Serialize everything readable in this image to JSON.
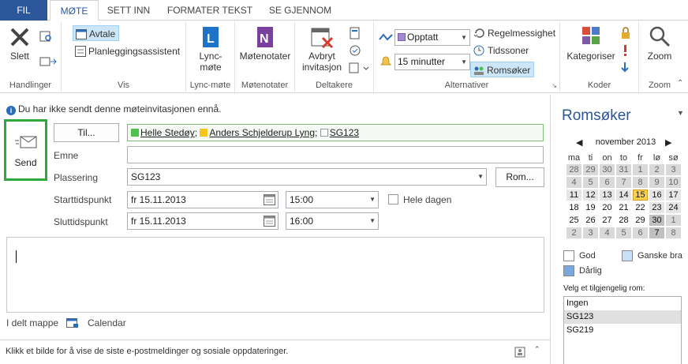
{
  "tabs": {
    "file": "FIL",
    "meeting": "MØTE",
    "insert": "SETT INN",
    "format": "FORMATER TEKST",
    "review": "SE GJENNOM"
  },
  "ribbon": {
    "actions": {
      "delete": "Slett",
      "label": "Handlinger"
    },
    "view": {
      "appointment": "Avtale",
      "scheduling": "Planleggingsassistent",
      "label": "Vis"
    },
    "lync": {
      "button_line1": "Lync-",
      "button_line2": "møte",
      "label": "Lync-møte"
    },
    "notes": {
      "button": "Møtenotater",
      "label": "Møtenotater"
    },
    "attendees": {
      "cancel_line1": "Avbryt",
      "cancel_line2": "invitasjon",
      "label": "Deltakere"
    },
    "options": {
      "show_as": "Opptatt",
      "reminder": "15 minutter",
      "recurrence": "Regelmessighet",
      "timezones": "Tidssoner",
      "room_finder": "Romsøker",
      "label": "Alternativer"
    },
    "tags": {
      "categorize": "Kategoriser",
      "label": "Koder"
    },
    "zoom": {
      "button": "Zoom",
      "label": "Zoom"
    }
  },
  "info_bar": "Du har ikke sendt denne møteinvitasjonen ennå.",
  "send": "Send",
  "form": {
    "to_button": "Til...",
    "attendees": [
      {
        "name": "Helle Stedøy",
        "color": "#4cc14c",
        "suffix": ";"
      },
      {
        "name": "Anders Schjelderup Lyng",
        "color": "#f5c518",
        "suffix": ";"
      },
      {
        "name": "SG123",
        "color": "#ffffff",
        "suffix": ""
      }
    ],
    "subject_label": "Emne",
    "subject_value": "",
    "location_label": "Plassering",
    "location_value": "SG123",
    "rooms_button": "Rom...",
    "start_label": "Starttidspunkt",
    "start_date": "fr 15.11.2013",
    "start_time": "15:00",
    "all_day": "Hele dagen",
    "end_label": "Sluttidspunkt",
    "end_date": "fr 15.11.2013",
    "end_time": "16:00"
  },
  "folder": {
    "label": "I delt mappe",
    "value": "Calendar"
  },
  "status_bar": "Klikk et bilde for å vise de siste e-postmeldinger og sosiale oppdateringer.",
  "room_finder": {
    "title": "Romsøker",
    "month": "november 2013",
    "weekdays": [
      "ma",
      "ti",
      "on",
      "to",
      "fr",
      "lø",
      "sø"
    ],
    "weeks": [
      [
        [
          "28",
          "dim"
        ],
        [
          "29",
          "dim"
        ],
        [
          "30",
          "dim"
        ],
        [
          "31",
          "dim"
        ],
        [
          "1",
          "dim"
        ],
        [
          "2",
          "dim"
        ],
        [
          "3",
          "dim"
        ]
      ],
      [
        [
          "4",
          "dim"
        ],
        [
          "5",
          "dim"
        ],
        [
          "6",
          "dim"
        ],
        [
          "7",
          "dim"
        ],
        [
          "8",
          "dim"
        ],
        [
          "9",
          "dim"
        ],
        [
          "10",
          "dim"
        ]
      ],
      [
        [
          "11",
          "ok"
        ],
        [
          "12",
          "ok"
        ],
        [
          "13",
          "ok"
        ],
        [
          "14",
          "ok"
        ],
        [
          "15",
          "today"
        ],
        [
          "16",
          "ok"
        ],
        [
          "17",
          "ok"
        ]
      ],
      [
        [
          "18",
          "w"
        ],
        [
          "19",
          "w"
        ],
        [
          "20",
          "w"
        ],
        [
          "21",
          "w"
        ],
        [
          "22",
          "w"
        ],
        [
          "23",
          "ok"
        ],
        [
          "24",
          "ok"
        ]
      ],
      [
        [
          "25",
          "w"
        ],
        [
          "26",
          "w"
        ],
        [
          "27",
          "w"
        ],
        [
          "28",
          "w"
        ],
        [
          "29",
          "w"
        ],
        [
          "30",
          "gray"
        ],
        [
          "1",
          "dim"
        ]
      ],
      [
        [
          "2",
          "dim"
        ],
        [
          "3",
          "dim"
        ],
        [
          "4",
          "dim"
        ],
        [
          "5",
          "dim"
        ],
        [
          "6",
          "dim"
        ],
        [
          "7",
          "gray"
        ],
        [
          "8",
          "dim"
        ]
      ]
    ],
    "legend": {
      "good": "God",
      "fair": "Ganske bra",
      "poor": "Dårlig"
    },
    "legend_colors": {
      "good": "#ffffff",
      "fair": "#c7dff7",
      "poor": "#7ba7e0"
    },
    "rooms_label": "Velg et tilgjengelig rom:",
    "rooms": [
      "Ingen",
      "SG123",
      "SG219"
    ],
    "selected_room": "SG123"
  }
}
